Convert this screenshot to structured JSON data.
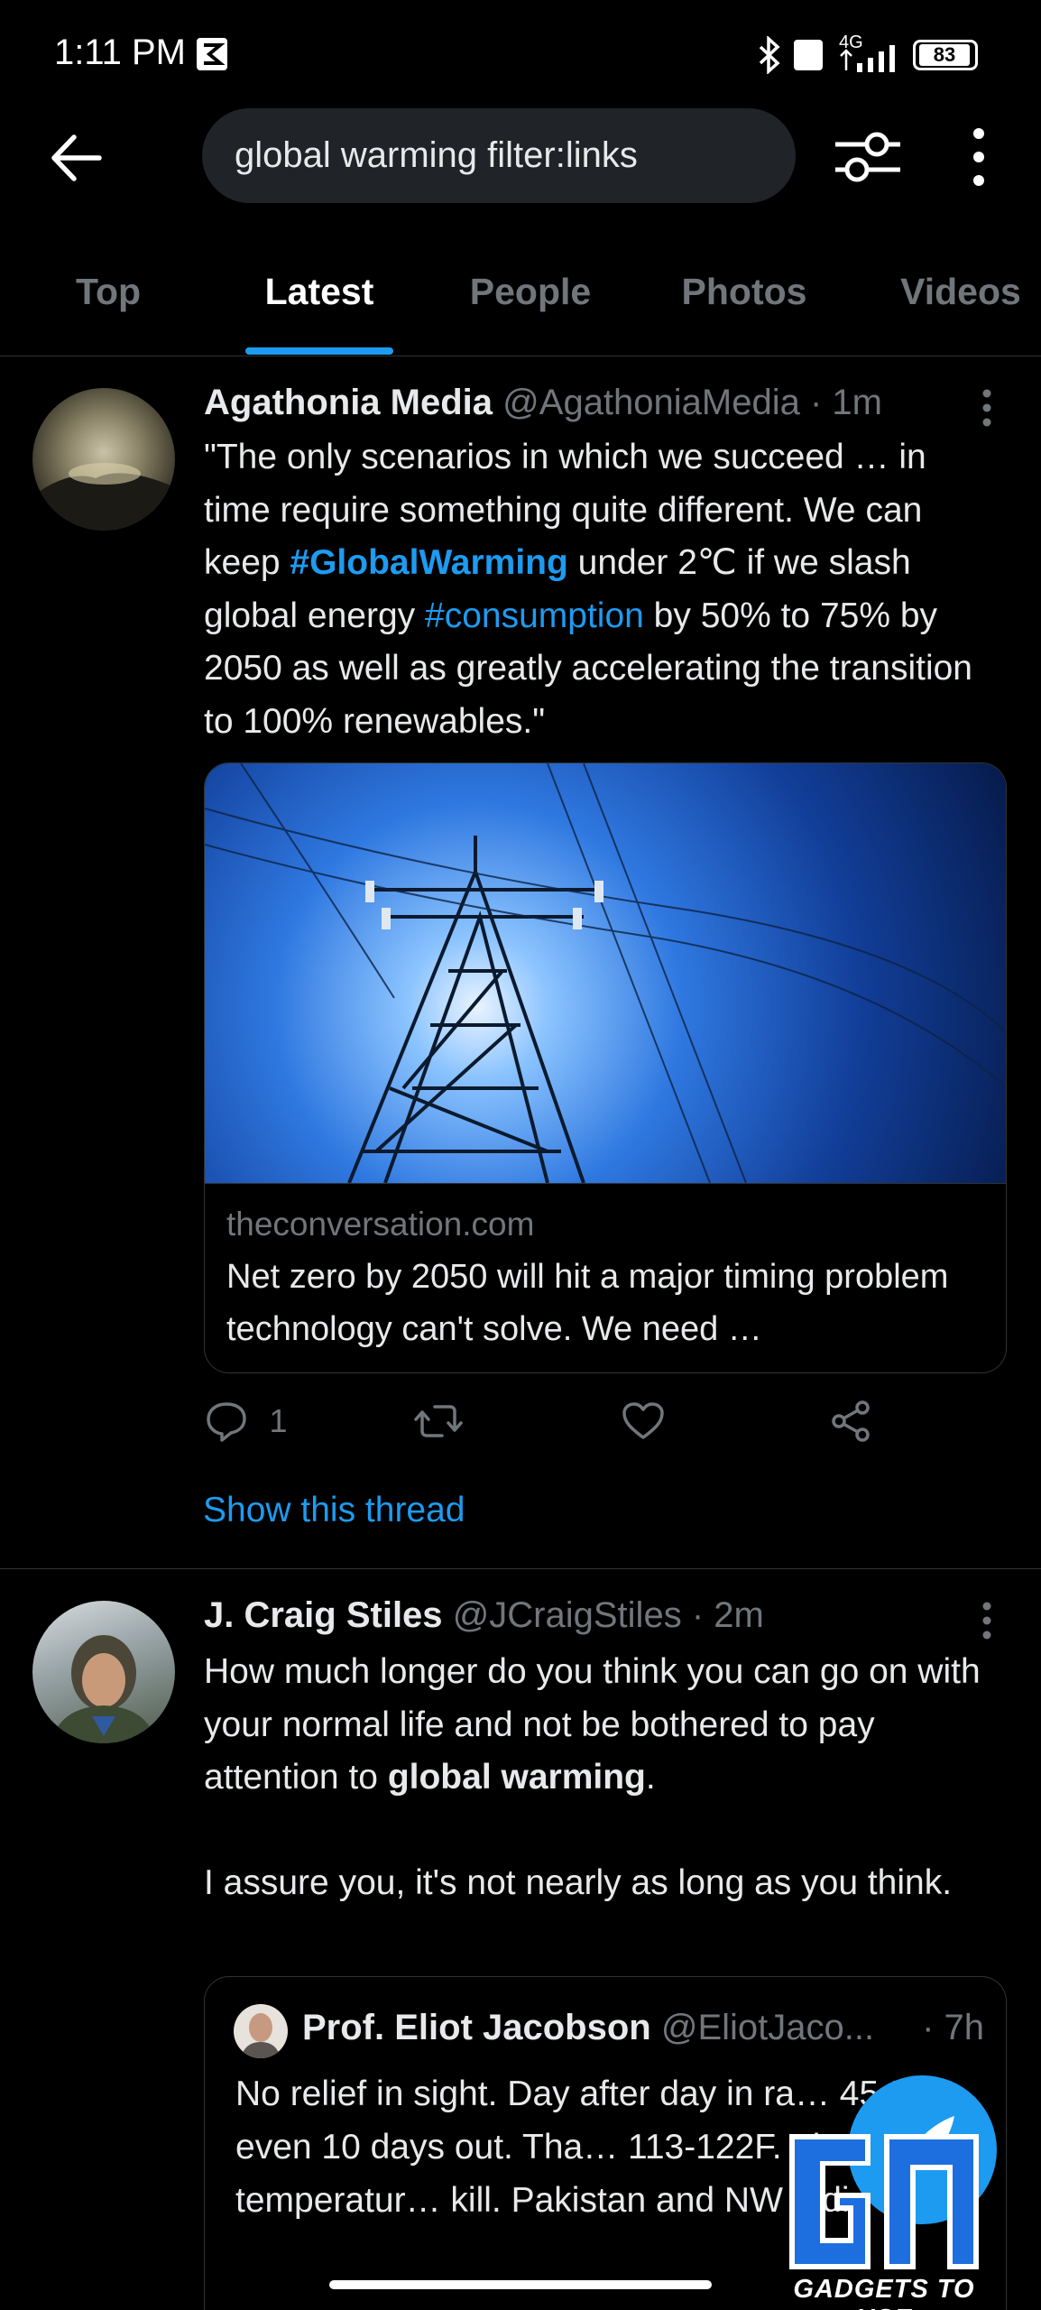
{
  "status_bar": {
    "time": "1:11 PM",
    "network": "4G",
    "battery": "83"
  },
  "search": {
    "query": "global warming filter:links"
  },
  "tabs": [
    {
      "label": "Top"
    },
    {
      "label": "Latest"
    },
    {
      "label": "People"
    },
    {
      "label": "Photos"
    },
    {
      "label": "Videos"
    }
  ],
  "tweet1": {
    "name": "Agathonia Media",
    "handle": "@AgathoniaMedia",
    "time": "· 1m",
    "text_part1": "\"The only scenarios in which we succeed … in time require something quite different. We can keep ",
    "hashtag1": "#GlobalWarming",
    "text_part2": " under 2℃ if we slash global energy ",
    "hashtag2": "#consumption",
    "text_part3": " by 50% to 75% by 2050 as well as greatly accelerating the transition to 100% renewables.\"",
    "card_domain": "theconversation.com",
    "card_title": "Net zero by 2050 will hit a major timing problem technology can't solve. We need …",
    "reply_count": "1",
    "show_thread": "Show this thread"
  },
  "tweet2": {
    "name": "J. Craig Stiles",
    "handle": "@JCraigStiles",
    "time": "· 2m",
    "text_part1": "How much longer do you think you can go on with your normal life and not be bothered to pay attention to ",
    "bold": "global warming",
    "text_part2": ".",
    "text_para2": "I assure you, it's not nearly as long as you think.",
    "quote": {
      "name": "Prof. Eliot Jacobson",
      "handle": "@EliotJaco...",
      "time": "· 7h",
      "text": "No relief in sight.  Day after day in ra… 45-50C, even 10 days out.  Tha… 113-122F. These are temperatur… kill. Pakistan and NW India are…"
    }
  },
  "watermark": {
    "text": "GADGETS TO USE"
  },
  "colors": {
    "accent": "#1d9bf0",
    "muted": "#71767b",
    "divider": "#2f3336"
  }
}
